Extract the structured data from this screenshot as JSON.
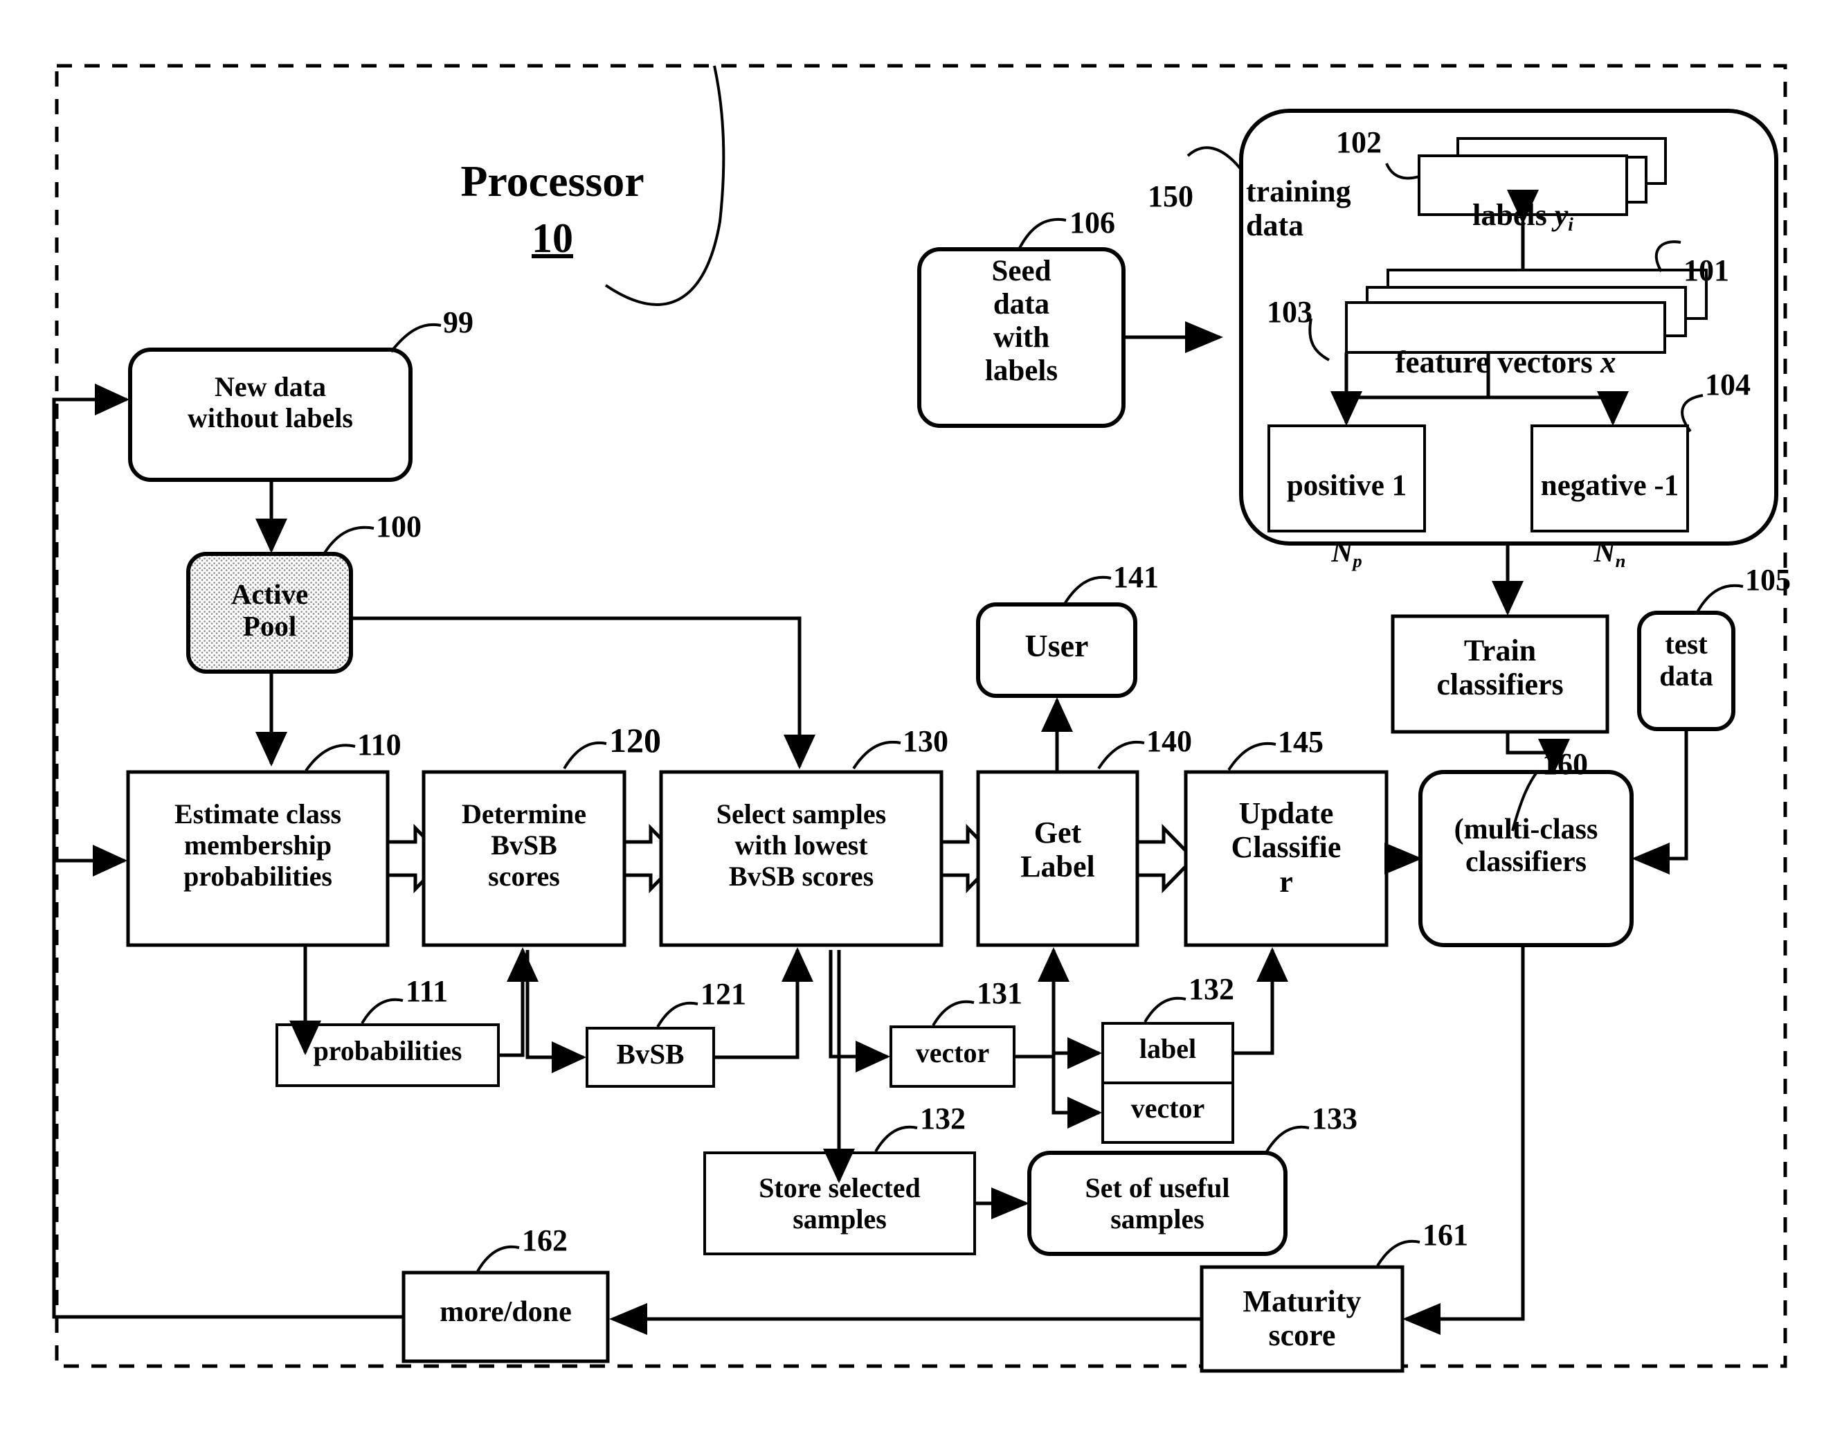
{
  "figure": {
    "title": "Processor",
    "title_ref": "10"
  },
  "nodes": {
    "new_data": {
      "label": "New data\nwithout labels",
      "ref": "99"
    },
    "active_pool": {
      "label": "Active\nPool",
      "ref": "100"
    },
    "estimate": {
      "label": "Estimate class\nmembership\nprobabilities",
      "ref": "110"
    },
    "probabilities": {
      "label": "probabilities",
      "ref": "111"
    },
    "determine": {
      "label": "Determine\nBvSB\nscores",
      "ref": "120"
    },
    "bvsb": {
      "label": "BvSB",
      "ref": "121"
    },
    "select": {
      "label": "Select samples\nwith lowest\nBvSB scores",
      "ref": "130"
    },
    "vector": {
      "label": "vector",
      "ref": "131"
    },
    "store_selected": {
      "label": "Store selected\nsamples",
      "ref": "132"
    },
    "label_vector_a": {
      "label": "label",
      "ref": "132"
    },
    "label_vector_b": {
      "label": "vector",
      "ref": ""
    },
    "set_useful": {
      "label": "Set of useful\nsamples",
      "ref": "133"
    },
    "get_label": {
      "label": "Get\nLabel",
      "ref": "140"
    },
    "user": {
      "label": "User",
      "ref": "141"
    },
    "update_classifier": {
      "label": "Update\nClassifie\nr",
      "ref": "145"
    },
    "training_data": {
      "label": "training\ndata",
      "ref": "150"
    },
    "feature_vectors": {
      "label": "feature vectors",
      "label_var": "x",
      "ref": "101"
    },
    "labels_y": {
      "label": "labels",
      "label_var": "y",
      "label_sub": "i",
      "ref": "102"
    },
    "positive": {
      "label": "positive 1",
      "label_var": "N",
      "label_sub": "p",
      "ref": "103"
    },
    "negative": {
      "label": "negative -1",
      "label_var": "N",
      "label_sub": "n",
      "ref": "104"
    },
    "test_data": {
      "label": "test\ndata",
      "ref": "105"
    },
    "seed_data": {
      "label": "Seed\ndata\nwith\nlabels",
      "ref": "106"
    },
    "train_classifiers": {
      "label": "Train\nclassifiers",
      "ref": ""
    },
    "multi_class": {
      "label": "(multi-class\nclassifiers",
      "ref": "160"
    },
    "maturity_score": {
      "label": "Maturity\nscore",
      "ref": "161"
    },
    "more_done": {
      "label": "more/done",
      "ref": "162"
    }
  },
  "colors": {
    "stroke": "#000000",
    "fill": "#ffffff",
    "stipple": "#9a9a9a"
  }
}
